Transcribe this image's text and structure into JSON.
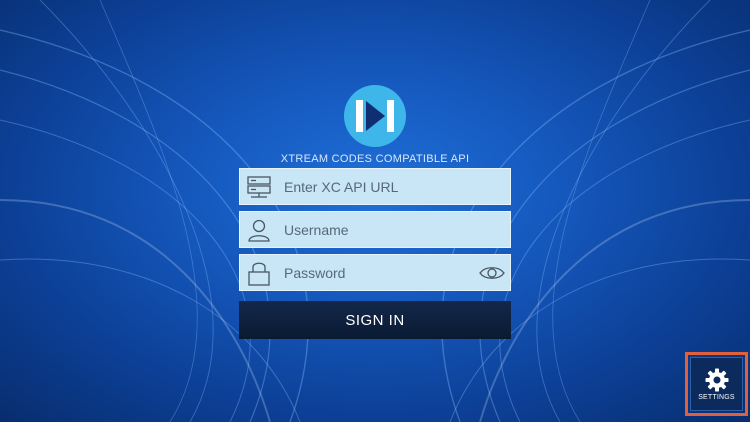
{
  "app": {
    "caption": "XTREAM CODES COMPATIBLE API"
  },
  "form": {
    "url_placeholder": "Enter XC API URL",
    "username_placeholder": "Username",
    "password_placeholder": "Password",
    "signin_label": "SIGN IN"
  },
  "settings": {
    "label": "SETTINGS"
  },
  "icons": {
    "logo": "play-logo-icon",
    "url": "server-icon",
    "username": "user-icon",
    "password": "lock-icon",
    "show_password": "eye-icon",
    "settings": "gear-icon"
  },
  "colors": {
    "field_bg": "#c8e6f5",
    "signin_bg": "#0a1a33",
    "highlight": "#e0603c",
    "logo": "#3fb6ea"
  }
}
